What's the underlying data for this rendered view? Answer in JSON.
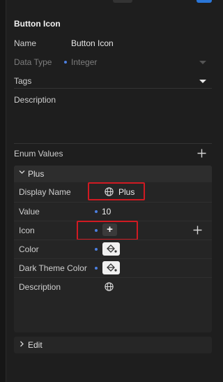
{
  "panel": {
    "title": "Button Icon"
  },
  "fields": {
    "name_label": "Name",
    "name_value": "Button Icon",
    "data_type_label": "Data Type",
    "data_type_value": "Integer",
    "tags_label": "Tags",
    "description_label": "Description"
  },
  "enum": {
    "header_label": "Enum Values",
    "item": {
      "title": "Plus",
      "display_name_label": "Display Name",
      "display_name_value": "Plus",
      "value_label": "Value",
      "value_value": "10",
      "icon_label": "Icon",
      "icon_symbol": "+",
      "color_label": "Color",
      "dark_theme_color_label": "Dark Theme Color",
      "description_label": "Description"
    },
    "edit_label": "Edit"
  },
  "colors": {
    "accent": "#2a76d8",
    "bound_dot": "#4c7fe0",
    "highlight": "#d01a22",
    "background": "#1e1e1e"
  },
  "icons": {
    "add": "plus-icon",
    "localize": "globe-icon",
    "swatch": "paint-bucket-icon",
    "expand": "chevron-down-icon",
    "collapse": "chevron-right-icon"
  }
}
